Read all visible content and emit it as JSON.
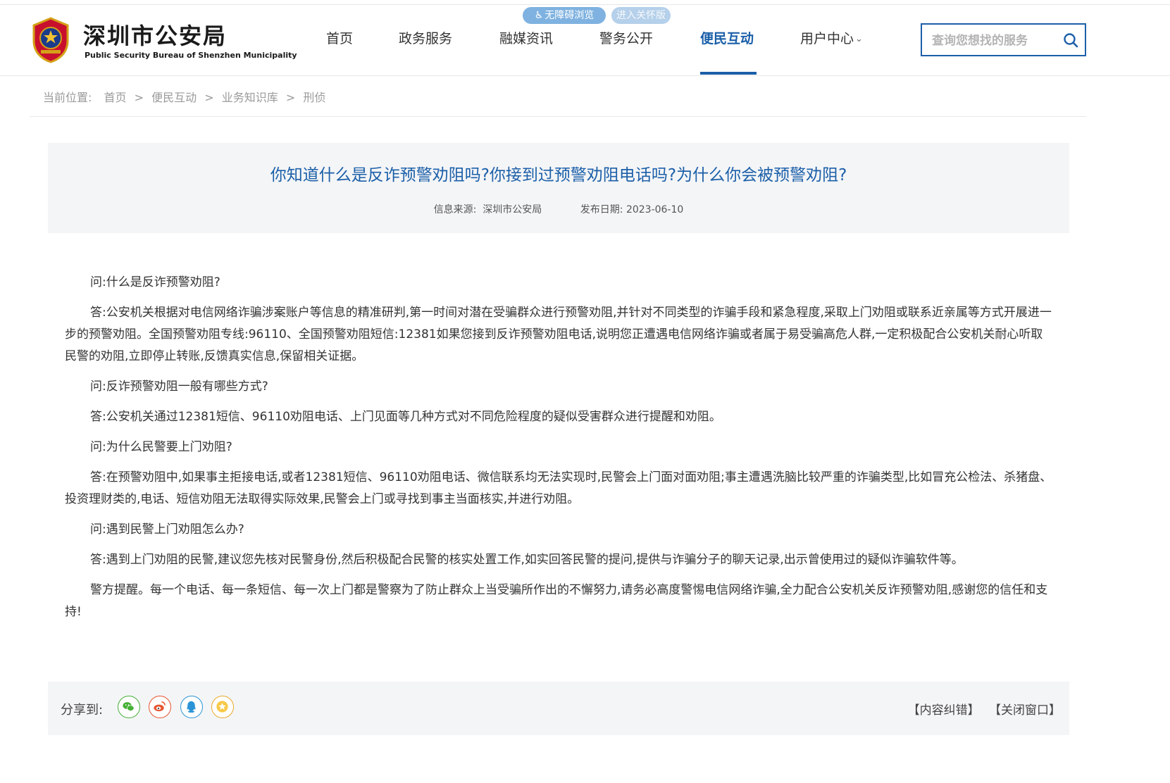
{
  "header": {
    "logo_cn": "深圳市公安局",
    "logo_en": "Public Security Bureau of Shenzhen Municipality",
    "accessibility": {
      "barrier_free": "无障碍浏览",
      "care_mode": "进入关怀版"
    },
    "nav": [
      {
        "label": "首页"
      },
      {
        "label": "政务服务"
      },
      {
        "label": "融媒资讯"
      },
      {
        "label": "警务公开"
      },
      {
        "label": "便民互动",
        "active": true
      },
      {
        "label": "用户中心"
      }
    ],
    "search": {
      "placeholder": "查询您想找的服务",
      "value": ""
    }
  },
  "breadcrumb": {
    "prefix": "当前位置:",
    "items": [
      "首页",
      "便民互动",
      "业务知识库",
      "刑侦"
    ],
    "separator": ">"
  },
  "article": {
    "title": "你知道什么是反诈预警劝阻吗?你接到过预警劝阻电话吗?为什么你会被预警劝阻?",
    "source_label": "信息来源:",
    "source": "深圳市公安局",
    "date_label": "发布日期:",
    "date": "2023-06-10",
    "paragraphs": [
      "问:什么是反诈预警劝阻?",
      "答:公安机关根据对电信网络诈骗涉案账户等信息的精准研判,第一时间对潜在受骗群众进行预警劝阻,并针对不同类型的诈骗手段和紧急程度,采取上门劝阻或联系近亲属等方式开展进一步的预警劝阻。全国预警劝阻专线:96110、全国预警劝阻短信:12381如果您接到反诈预警劝阻电话,说明您正遭遇电信网络诈骗或者属于易受骗高危人群,一定积极配合公安机关耐心听取民警的劝阻,立即停止转账,反馈真实信息,保留相关证据。",
      "问:反诈预警劝阻一般有哪些方式?",
      "答:公安机关通过12381短信、96110劝阻电话、上门见面等几种方式对不同危险程度的疑似受害群众进行提醒和劝阻。",
      "问:为什么民警要上门劝阻?",
      "答:在预警劝阻中,如果事主拒接电话,或者12381短信、96110劝阻电话、微信联系均无法实现时,民警会上门面对面劝阻;事主遭遇洗脑比较严重的诈骗类型,比如冒充公检法、杀猪盘、投资理财类的,电话、短信劝阻无法取得实际效果,民警会上门或寻找到事主当面核实,并进行劝阻。",
      "问:遇到民警上门劝阻怎么办?",
      "答:遇到上门劝阻的民警,建议您先核对民警身份,然后积极配合民警的核实处置工作,如实回答民警的提问,提供与诈骗分子的聊天记录,出示曾使用过的疑似诈骗软件等。",
      "警方提醒。每一个电话、每一条短信、每一次上门都是警察为了防止群众上当受骗所作出的不懈努力,请务必高度警惕电信网络诈骗,全力配合公安机关反诈预警劝阻,感谢您的信任和支持!"
    ]
  },
  "share": {
    "label": "分享到:",
    "icons": [
      "wechat-icon",
      "weibo-icon",
      "qq-icon",
      "favorite-icon"
    ],
    "links": [
      "【内容纠错】",
      "【关闭窗口】"
    ]
  },
  "colors": {
    "accent": "#1b5fa8",
    "panel_bg": "#f4f5f7",
    "muted_text": "#9a9a9a"
  }
}
